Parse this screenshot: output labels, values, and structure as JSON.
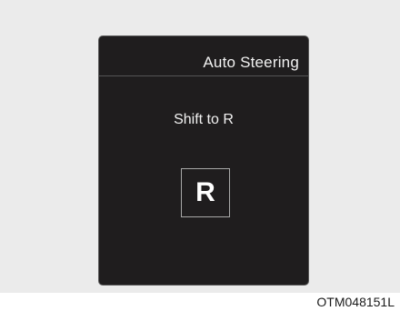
{
  "cluster": {
    "title": "Auto Steering",
    "message": "Shift to R",
    "gear_indicator": "R"
  },
  "figure_code": "OTM048151L",
  "colors": {
    "background_panel": "#ebebeb",
    "display_background": "#1f1d1e",
    "display_text": "#f2f2f2"
  }
}
